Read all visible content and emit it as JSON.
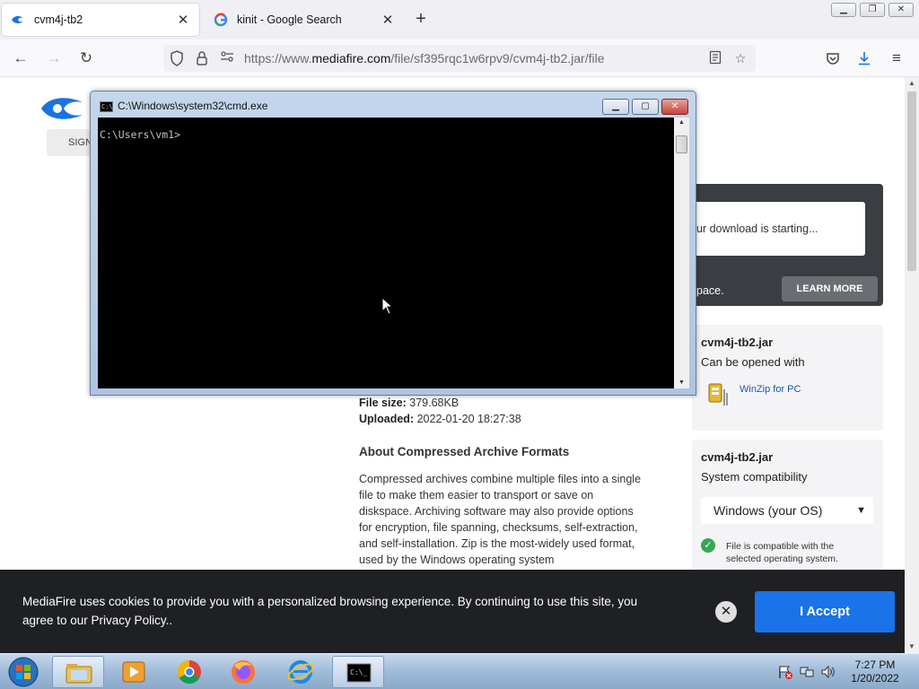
{
  "browser": {
    "tabs": [
      {
        "title": "cvm4j-tb2",
        "active": true,
        "icon": "mediafire-favicon"
      },
      {
        "title": "kinit - Google Search",
        "active": false,
        "icon": "google-favicon"
      }
    ],
    "url_prefix": "https://www.",
    "url_domain": "mediafire.com",
    "url_path": "/file/sf395rqc1w6rpv9/cvm4j-tb2.jar/file"
  },
  "page": {
    "signin_label": "SIGN",
    "download_message": "ur download is starting...",
    "space_text": "pace.",
    "learn_more_label": "LEARN MORE",
    "open_card": {
      "filename": "cvm4j-tb2.jar",
      "subtitle": "Can be opened with",
      "app_link": "WinZip for PC"
    },
    "compat_card": {
      "filename": "cvm4j-tb2.jar",
      "subtitle": "System compatibility",
      "os_selected": "Windows (your OS)",
      "compat_text": "File is compatible with the selected operating system."
    },
    "file_size_label": "File size:",
    "file_size_value": "379.68KB",
    "uploaded_label": "Uploaded:",
    "uploaded_value": "2022-01-20 18:27:38",
    "about_heading": "About Compressed Archive Formats",
    "about_text": "Compressed archives combine multiple files into a single file to make them easier to transport or save on diskspace. Archiving software may also provide options for encryption, file spanning, checksums, self-extraction, and self-installation. Zip is the most-widely used format, used by the Windows operating system"
  },
  "cookie_banner": {
    "text": "MediaFire uses cookies to provide you with a personalized browsing experience. By continuing to use this site, you agree to our Privacy Policy..",
    "accept_label": "I Accept"
  },
  "cmd_window": {
    "title": "C:\\Windows\\system32\\cmd.exe",
    "prompt": "C:\\Users\\vm1>"
  },
  "taskbar": {
    "items": [
      "explorer",
      "media-player",
      "chrome",
      "firefox",
      "internet-explorer",
      "cmd"
    ],
    "time": "7:27 PM",
    "date": "1/20/2022"
  },
  "colors": {
    "accent": "#1a73e8",
    "mediafire_blue": "#1874e0",
    "console_bg": "#000000"
  }
}
